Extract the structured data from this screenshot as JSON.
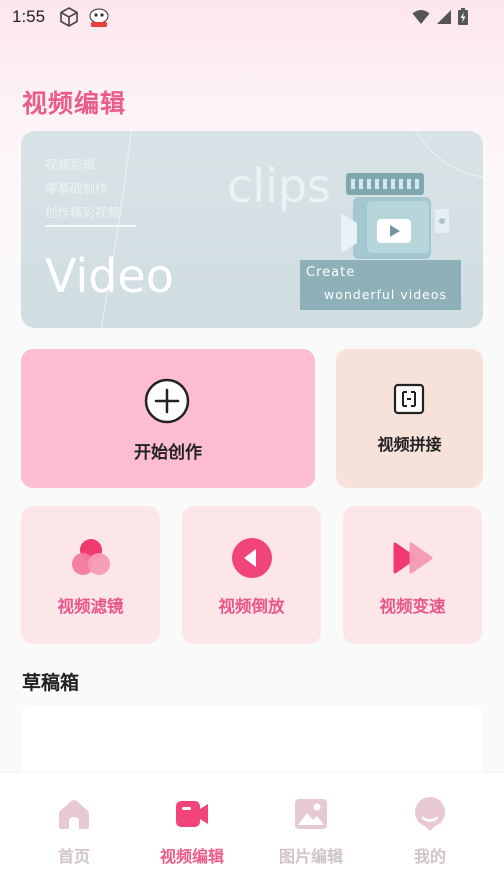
{
  "status_bar": {
    "time": "1:55",
    "icons": [
      "cube-icon",
      "app-notification-icon",
      "wifi-icon",
      "signal-icon",
      "battery-charging-icon"
    ]
  },
  "page_title": "视频编辑",
  "banner": {
    "lines": [
      "视频剪辑",
      "零基础制作",
      "创作精彩视频"
    ],
    "big_word": "Video",
    "watermark_word": "clips",
    "box_line1": "Create",
    "box_line2": "wonderful videos"
  },
  "actions": {
    "start": {
      "label": "开始创作",
      "icon": "plus-circle-icon"
    },
    "splice": {
      "label": "视频拼接",
      "icon": "splice-icon"
    },
    "filter": {
      "label": "视频滤镜",
      "icon": "filter-icon"
    },
    "reverse": {
      "label": "视频倒放",
      "icon": "reverse-play-icon"
    },
    "speed": {
      "label": "视频变速",
      "icon": "fast-forward-icon"
    }
  },
  "drafts": {
    "title": "草稿箱"
  },
  "bottom_nav": {
    "items": [
      {
        "label": "首页",
        "icon": "home-icon",
        "active": false
      },
      {
        "label": "视频编辑",
        "icon": "video-camera-icon",
        "active": true
      },
      {
        "label": "图片编辑",
        "icon": "image-icon",
        "active": false
      },
      {
        "label": "我的",
        "icon": "profile-icon",
        "active": false
      }
    ]
  },
  "colors": {
    "accent": "#ec5c8a",
    "start_card": "#ffbdd3",
    "splice_card": "#f6e2d8",
    "small_card": "#fce6e8",
    "inactive_nav": "#cfc4c9"
  }
}
